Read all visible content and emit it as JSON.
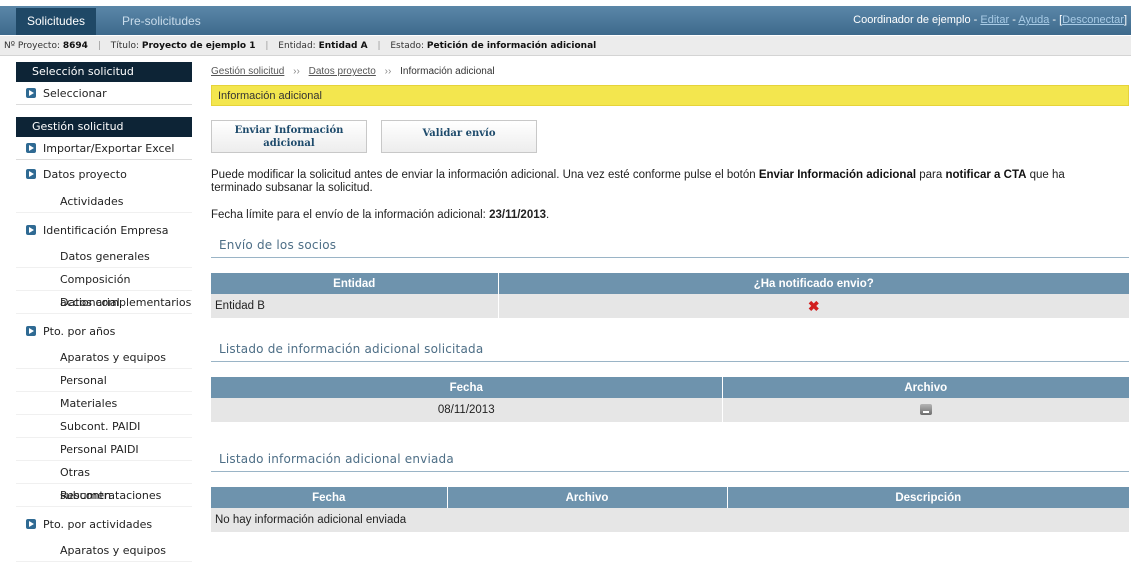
{
  "topbar": {
    "tabs": [
      "Solicitudes",
      "Pre-solicitudes"
    ],
    "user": "Coordinador de ejemplo",
    "links": [
      "Editar",
      "Ayuda",
      "Desconectar"
    ]
  },
  "infobar": {
    "proyecto_label": "Nº Proyecto:",
    "proyecto_value": "8694",
    "titulo_label": "Título:",
    "titulo_value": "Proyecto de ejemplo 1",
    "entidad_label": "Entidad:",
    "entidad_value": "Entidad A",
    "estado_label": "Estado:",
    "estado_value": "Petición de información adicional"
  },
  "sidebar": {
    "seleccion_head": "Selección solicitud",
    "seleccionar": "Seleccionar",
    "gestion_head": "Gestión solicitud",
    "importar": "Importar/Exportar Excel",
    "datos_proyecto": "Datos proyecto",
    "actividades": "Actividades",
    "identificacion": "Identificación Empresa",
    "datos_generales": "Datos generales",
    "composicion": "Composición accionarial",
    "datos_complementarios": "Datos complementarios",
    "pto_anos": "Pto. por años",
    "aparatos": "Aparatos y equipos",
    "personal": "Personal",
    "materiales": "Materiales",
    "subcont_paidi": "Subcont. PAIDI",
    "personal_paidi": "Personal PAIDI",
    "otras": "Otras subcontrataciones",
    "resumen": "Resumen",
    "pto_actividades": "Pto. por actividades",
    "aparatos2": "Aparatos y equipos"
  },
  "breadcrumb": [
    "Gestión solicitud",
    "Datos proyecto",
    "Información adicional"
  ],
  "banner": "Información adicional",
  "buttons": {
    "enviar_line1": "Enviar Información",
    "enviar_line2": "adicional",
    "validar": "Validar envío"
  },
  "intro": {
    "part1": "Puede modificar la solicitud antes de enviar la información adicional. Una vez esté conforme pulse el botón ",
    "bold1": "Enviar Información adicional",
    "part2": " para ",
    "bold2": "notificar a CTA",
    "part3": " que ha terminado subsanar la solicitud."
  },
  "deadline": {
    "label": "Fecha límite para el envío de la información adicional: ",
    "date": "23/11/2013",
    "end": "."
  },
  "socios": {
    "title": "Envío de los socios",
    "headers": [
      "Entidad",
      "¿Ha notificado envio?"
    ],
    "rows": [
      {
        "entidad": "Entidad B",
        "notificado": "✖"
      }
    ]
  },
  "solicitada": {
    "title": "Listado de información adicional solicitada",
    "headers": [
      "Fecha",
      "Archivo"
    ],
    "rows": [
      {
        "fecha": "08/11/2013"
      }
    ]
  },
  "enviada": {
    "title": "Listado información adicional enviada",
    "headers": [
      "Fecha",
      "Archivo",
      "Descripción"
    ],
    "empty": "No hay información adicional enviada"
  }
}
